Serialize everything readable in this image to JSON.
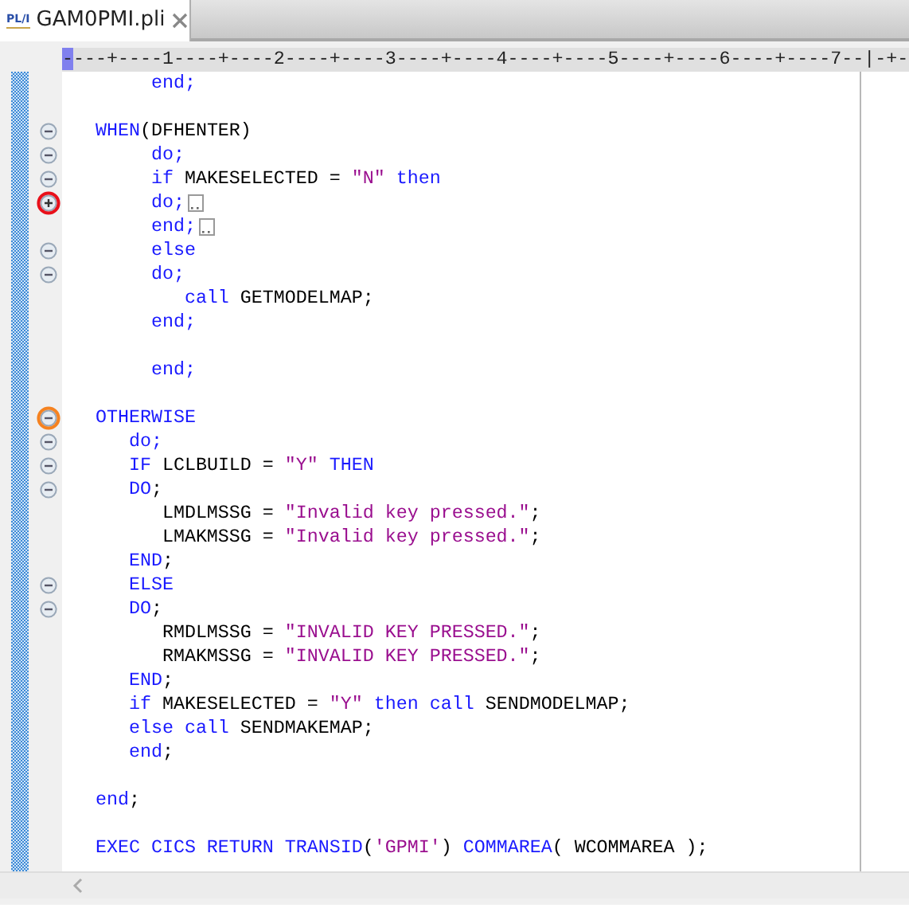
{
  "tab": {
    "icon_label": "PL/I",
    "title": "GAM0PMI.pli",
    "selected": true
  },
  "ruler": "----+----1----+----2----+----3----+----4----+----5----+----6----+----7--|-+-",
  "lines": [
    {
      "kind": "code",
      "segments": [
        {
          "kind": "keyword",
          "text": "        end;"
        }
      ]
    },
    {
      "kind": "blank"
    },
    {
      "kind": "code",
      "fold": {
        "kind": "collapse"
      },
      "segments": [
        {
          "kind": "keyword",
          "text": "   WHEN"
        },
        {
          "kind": "plain",
          "text": "(DFHENTER)"
        }
      ]
    },
    {
      "kind": "code",
      "fold": {
        "kind": "collapse"
      },
      "segments": [
        {
          "kind": "keyword",
          "text": "        do;"
        }
      ]
    },
    {
      "kind": "code",
      "fold": {
        "kind": "collapse"
      },
      "segments": [
        {
          "kind": "keyword",
          "text": "        if"
        },
        {
          "kind": "plain",
          "text": " MAKESELECTED = "
        },
        {
          "kind": "string",
          "text": "\"N\""
        },
        {
          "kind": "keyword",
          "text": " then"
        }
      ]
    },
    {
      "kind": "code",
      "fold": {
        "kind": "expand",
        "color": "#e8101a"
      },
      "folded": true,
      "segments": [
        {
          "kind": "keyword",
          "text": "        do;"
        }
      ]
    },
    {
      "kind": "code",
      "folded": true,
      "segments": [
        {
          "kind": "keyword",
          "text": "        end;"
        }
      ]
    },
    {
      "kind": "code",
      "fold": {
        "kind": "collapse"
      },
      "segments": [
        {
          "kind": "keyword",
          "text": "        else"
        }
      ]
    },
    {
      "kind": "code",
      "fold": {
        "kind": "collapse"
      },
      "segments": [
        {
          "kind": "keyword",
          "text": "        do;"
        }
      ]
    },
    {
      "kind": "code",
      "segments": [
        {
          "kind": "keyword",
          "text": "           call"
        },
        {
          "kind": "plain",
          "text": " GETMODELMAP;"
        }
      ]
    },
    {
      "kind": "code",
      "segments": [
        {
          "kind": "keyword",
          "text": "        end;"
        }
      ]
    },
    {
      "kind": "blank"
    },
    {
      "kind": "code",
      "segments": [
        {
          "kind": "keyword",
          "text": "        end;"
        }
      ]
    },
    {
      "kind": "blank"
    },
    {
      "kind": "code",
      "fold": {
        "kind": "collapse",
        "color": "#f58220"
      },
      "segments": [
        {
          "kind": "keyword",
          "text": "   OTHERWISE"
        }
      ]
    },
    {
      "kind": "code",
      "fold": {
        "kind": "collapse"
      },
      "segments": [
        {
          "kind": "keyword",
          "text": "      do;"
        }
      ]
    },
    {
      "kind": "code",
      "fold": {
        "kind": "collapse"
      },
      "segments": [
        {
          "kind": "keyword",
          "text": "      IF"
        },
        {
          "kind": "plain",
          "text": " LCLBUILD = "
        },
        {
          "kind": "string",
          "text": "\"Y\""
        },
        {
          "kind": "keyword",
          "text": " THEN"
        }
      ]
    },
    {
      "kind": "code",
      "fold": {
        "kind": "collapse"
      },
      "segments": [
        {
          "kind": "keyword",
          "text": "      DO"
        },
        {
          "kind": "plain",
          "text": ";"
        }
      ]
    },
    {
      "kind": "code",
      "segments": [
        {
          "kind": "plain",
          "text": "         LMDLMSSG = "
        },
        {
          "kind": "string",
          "text": "\"Invalid key pressed.\""
        },
        {
          "kind": "plain",
          "text": ";"
        }
      ]
    },
    {
      "kind": "code",
      "segments": [
        {
          "kind": "plain",
          "text": "         LMAKMSSG = "
        },
        {
          "kind": "string",
          "text": "\"Invalid key pressed.\""
        },
        {
          "kind": "plain",
          "text": ";"
        }
      ]
    },
    {
      "kind": "code",
      "segments": [
        {
          "kind": "keyword",
          "text": "      END"
        },
        {
          "kind": "plain",
          "text": ";"
        }
      ]
    },
    {
      "kind": "code",
      "fold": {
        "kind": "collapse"
      },
      "segments": [
        {
          "kind": "keyword",
          "text": "      ELSE"
        }
      ]
    },
    {
      "kind": "code",
      "fold": {
        "kind": "collapse"
      },
      "segments": [
        {
          "kind": "keyword",
          "text": "      DO"
        },
        {
          "kind": "plain",
          "text": ";"
        }
      ]
    },
    {
      "kind": "code",
      "segments": [
        {
          "kind": "plain",
          "text": "         RMDLMSSG = "
        },
        {
          "kind": "string",
          "text": "\"INVALID KEY PRESSED.\""
        },
        {
          "kind": "plain",
          "text": ";"
        }
      ]
    },
    {
      "kind": "code",
      "segments": [
        {
          "kind": "plain",
          "text": "         RMAKMSSG = "
        },
        {
          "kind": "string",
          "text": "\"INVALID KEY PRESSED.\""
        },
        {
          "kind": "plain",
          "text": ";"
        }
      ]
    },
    {
      "kind": "code",
      "segments": [
        {
          "kind": "keyword",
          "text": "      END"
        },
        {
          "kind": "plain",
          "text": ";"
        }
      ]
    },
    {
      "kind": "code",
      "segments": [
        {
          "kind": "keyword",
          "text": "      if"
        },
        {
          "kind": "plain",
          "text": " MAKESELECTED = "
        },
        {
          "kind": "string",
          "text": "\"Y\""
        },
        {
          "kind": "keyword",
          "text": " then call"
        },
        {
          "kind": "plain",
          "text": " SENDMODELMAP;"
        }
      ]
    },
    {
      "kind": "code",
      "segments": [
        {
          "kind": "keyword",
          "text": "      else call"
        },
        {
          "kind": "plain",
          "text": " SENDMAKEMAP;"
        }
      ]
    },
    {
      "kind": "code",
      "segments": [
        {
          "kind": "keyword",
          "text": "      end"
        },
        {
          "kind": "plain",
          "text": ";"
        }
      ]
    },
    {
      "kind": "blank"
    },
    {
      "kind": "code",
      "segments": [
        {
          "kind": "keyword",
          "text": "   end"
        },
        {
          "kind": "plain",
          "text": ";"
        }
      ]
    },
    {
      "kind": "blank"
    },
    {
      "kind": "code",
      "segments": [
        {
          "kind": "keyword",
          "text": "   EXEC CICS RETURN TRANSID"
        },
        {
          "kind": "plain",
          "text": "("
        },
        {
          "kind": "string",
          "text": "'GPMI'"
        },
        {
          "kind": "plain",
          "text": ") "
        },
        {
          "kind": "keyword",
          "text": "COMMAREA"
        },
        {
          "kind": "plain",
          "text": "( WCOMMAREA );"
        }
      ]
    }
  ]
}
